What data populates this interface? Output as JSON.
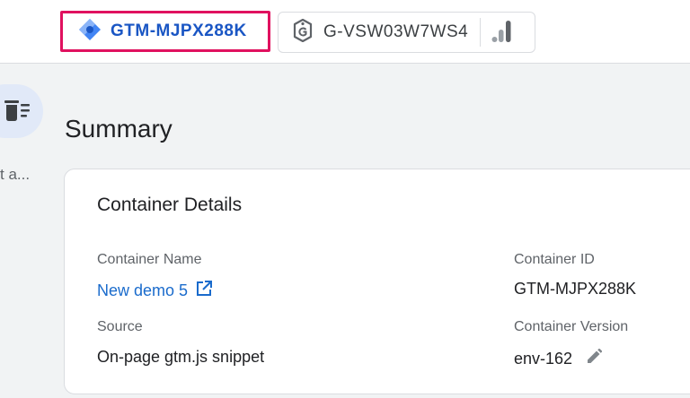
{
  "header": {
    "gtm_chip_label": "GTM-MJPX288K",
    "ga_chip_label": "G-VSW03W7WS4"
  },
  "sidebar": {
    "truncated_label": "t a..."
  },
  "page": {
    "title": "Summary"
  },
  "container_details": {
    "title": "Container Details",
    "name_label": "Container Name",
    "name_value": "New demo 5",
    "id_label": "Container ID",
    "id_value": "GTM-MJPX288K",
    "source_label": "Source",
    "source_value": "On-page gtm.js snippet",
    "version_label": "Container Version",
    "version_value": "env-162"
  },
  "colors": {
    "highlight_border": "#e0115f",
    "gtm_blue": "#1a56c4",
    "link_blue": "#1a6bcc",
    "sidebar_active_bg": "#e1e9f8"
  },
  "icons": {
    "gtm_logo": "gtm-diamond-icon",
    "ga_tag": "google-tag-icon",
    "analytics": "analytics-bars-icon",
    "sidebar": "summary-icon",
    "external_link": "open-in-new-icon",
    "edit": "pencil-icon"
  }
}
